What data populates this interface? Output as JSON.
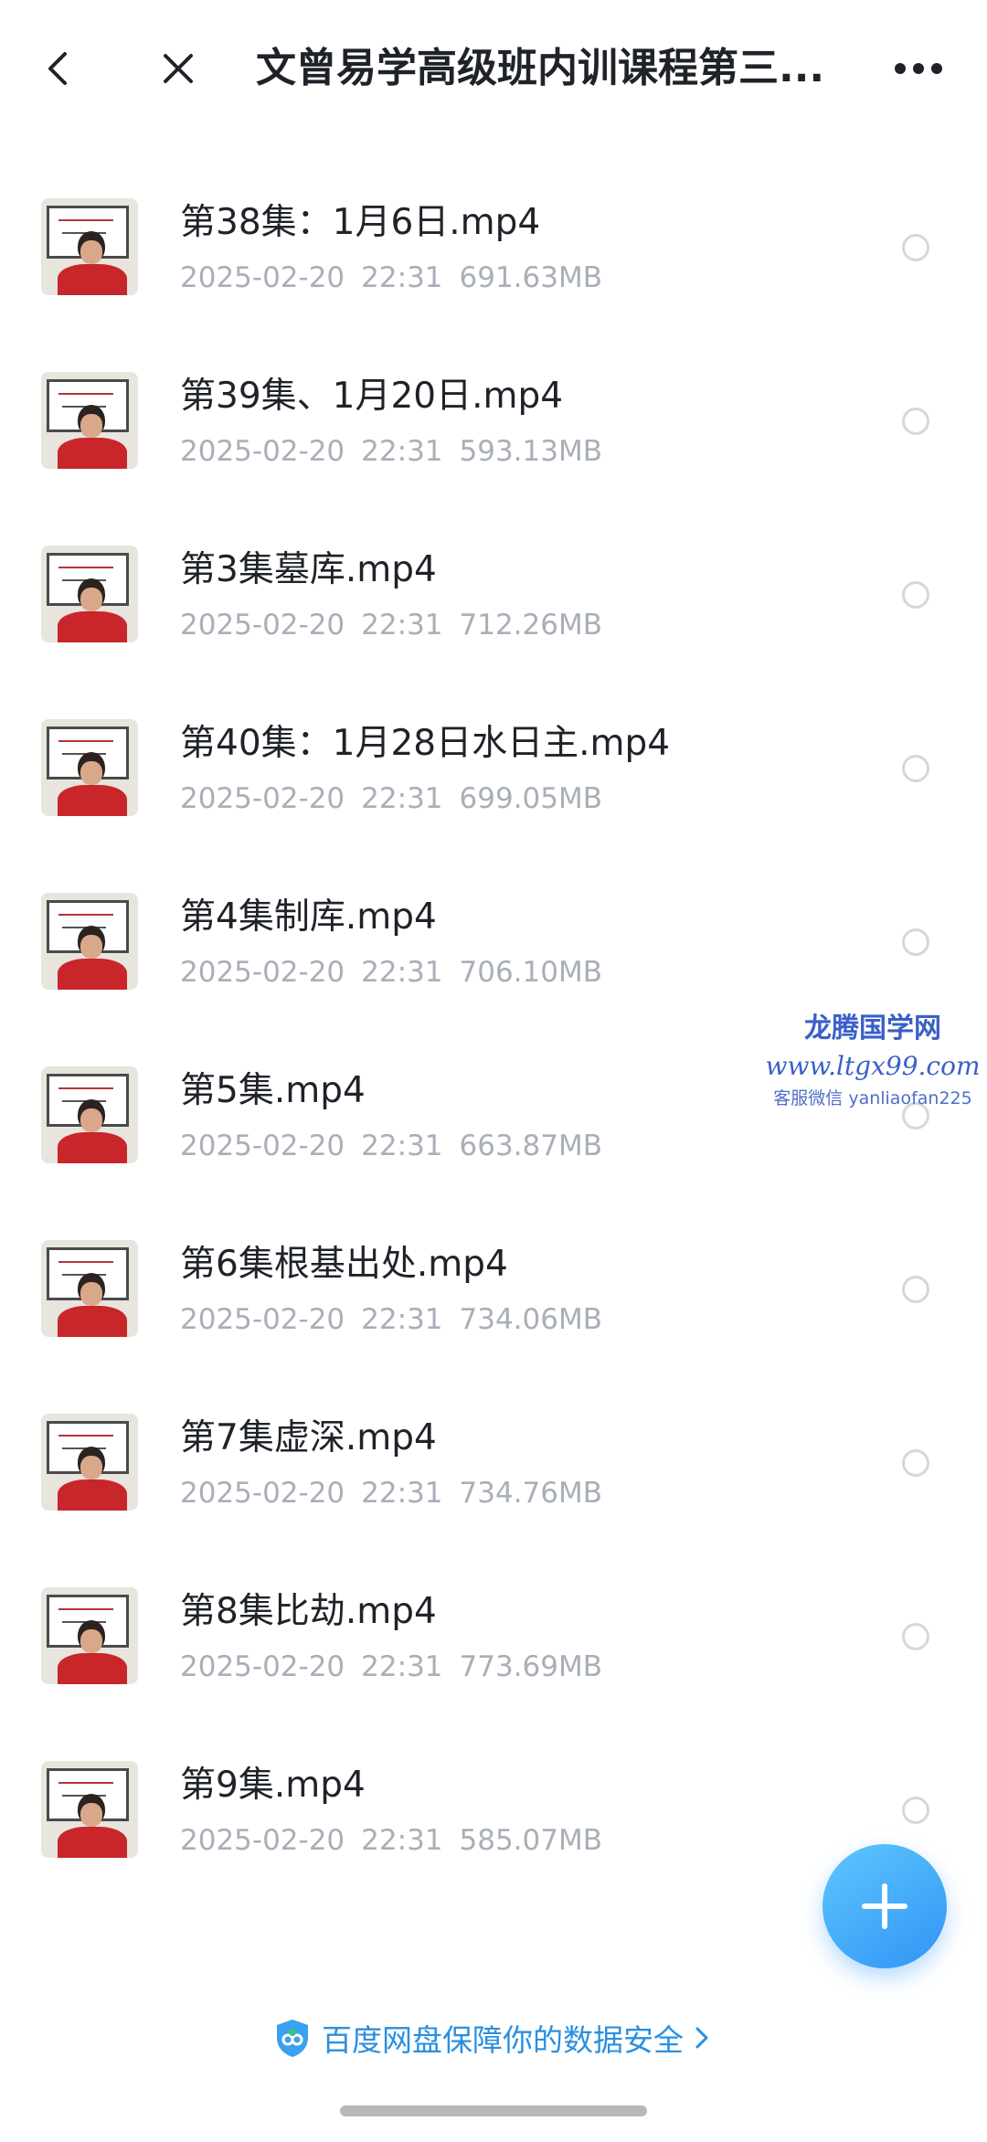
{
  "header": {
    "title": "文曾易学高级班内训课程第三..."
  },
  "files": [
    {
      "name": "第38集：1月6日.mp4",
      "date": "2025-02-20",
      "time": "22:31",
      "size": "691.63MB"
    },
    {
      "name": "第39集、1月20日.mp4",
      "date": "2025-02-20",
      "time": "22:31",
      "size": "593.13MB"
    },
    {
      "name": "第3集墓库.mp4",
      "date": "2025-02-20",
      "time": "22:31",
      "size": "712.26MB"
    },
    {
      "name": "第40集：1月28日水日主.mp4",
      "date": "2025-02-20",
      "time": "22:31",
      "size": "699.05MB"
    },
    {
      "name": "第4集制库.mp4",
      "date": "2025-02-20",
      "time": "22:31",
      "size": "706.10MB"
    },
    {
      "name": "第5集.mp4",
      "date": "2025-02-20",
      "time": "22:31",
      "size": "663.87MB"
    },
    {
      "name": "第6集根基出处.mp4",
      "date": "2025-02-20",
      "time": "22:31",
      "size": "734.06MB"
    },
    {
      "name": "第7集虚深.mp4",
      "date": "2025-02-20",
      "time": "22:31",
      "size": "734.76MB"
    },
    {
      "name": "第8集比劫.mp4",
      "date": "2025-02-20",
      "time": "22:31",
      "size": "773.69MB"
    },
    {
      "name": "第9集.mp4",
      "date": "2025-02-20",
      "time": "22:31",
      "size": "585.07MB"
    }
  ],
  "watermark": {
    "title": "龙腾国学网",
    "url": "www.ltgx99.com",
    "contact": "客服微信 yanliaofan225"
  },
  "footer": {
    "text": "百度网盘保障你的数据安全"
  },
  "colors": {
    "accent": "#2f95f5",
    "meta_text": "#a9afb8",
    "title_text": "#1f2329"
  }
}
